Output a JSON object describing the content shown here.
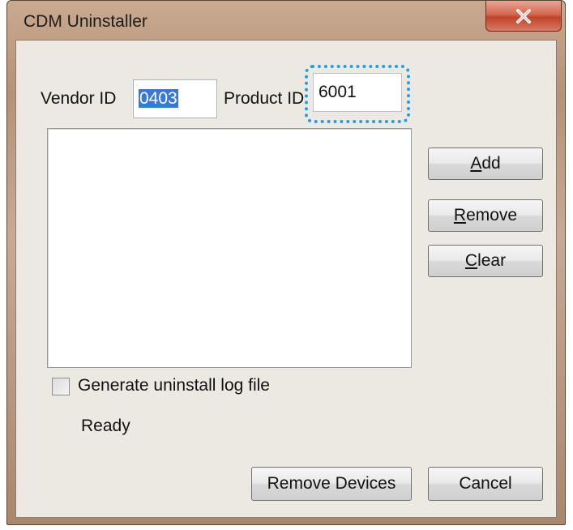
{
  "window": {
    "title": "CDM Uninstaller",
    "close_icon": "close-x-icon"
  },
  "vendor": {
    "label": "Vendor ID",
    "value": "0403"
  },
  "product": {
    "label": "Product ID",
    "value": "6001"
  },
  "device_list": {
    "items": []
  },
  "side_buttons": {
    "add": {
      "accel": "A",
      "rest": "dd"
    },
    "remove": {
      "accel": "R",
      "rest": "emove"
    },
    "clear": {
      "accel": "C",
      "rest": "lear"
    }
  },
  "log_option": {
    "label": "Generate uninstall log file",
    "checked": false
  },
  "status": {
    "text": "Ready"
  },
  "footer": {
    "remove_devices_label": "Remove Devices",
    "cancel_label": "Cancel"
  },
  "colors": {
    "selection": "#3a78d6",
    "focus_ring": "#1ea0e6",
    "close_button": "#c0432c"
  }
}
